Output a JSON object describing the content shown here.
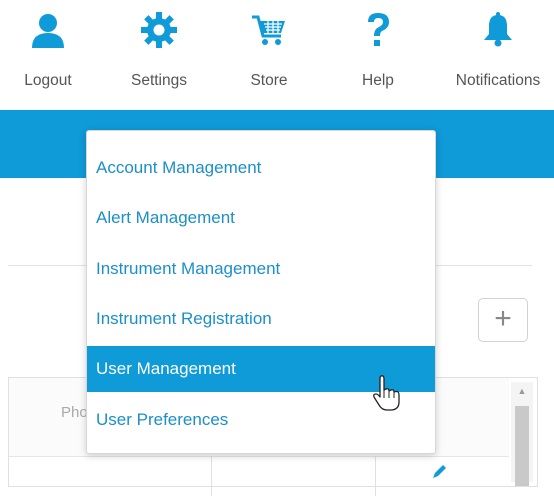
{
  "nav": {
    "items": [
      {
        "label": "Logout",
        "icon": "user-icon"
      },
      {
        "label": "Settings",
        "icon": "gear-icon"
      },
      {
        "label": "Store",
        "icon": "cart-icon"
      },
      {
        "label": "Help",
        "icon": "question-icon"
      },
      {
        "label": "Notifications",
        "icon": "bell-icon"
      }
    ]
  },
  "colors": {
    "accent": "#0f9ad8",
    "link": "#1b8fc9",
    "nav_text": "#555555"
  },
  "toolbar": {
    "add_label": "+"
  },
  "table": {
    "column_header": "Phone"
  },
  "dropdown": {
    "items": [
      {
        "label": "Account Management"
      },
      {
        "label": "Alert Management"
      },
      {
        "label": "Instrument Management"
      },
      {
        "label": "Instrument Registration"
      },
      {
        "label": "User Management",
        "active": true
      },
      {
        "label": "User Preferences"
      }
    ]
  }
}
